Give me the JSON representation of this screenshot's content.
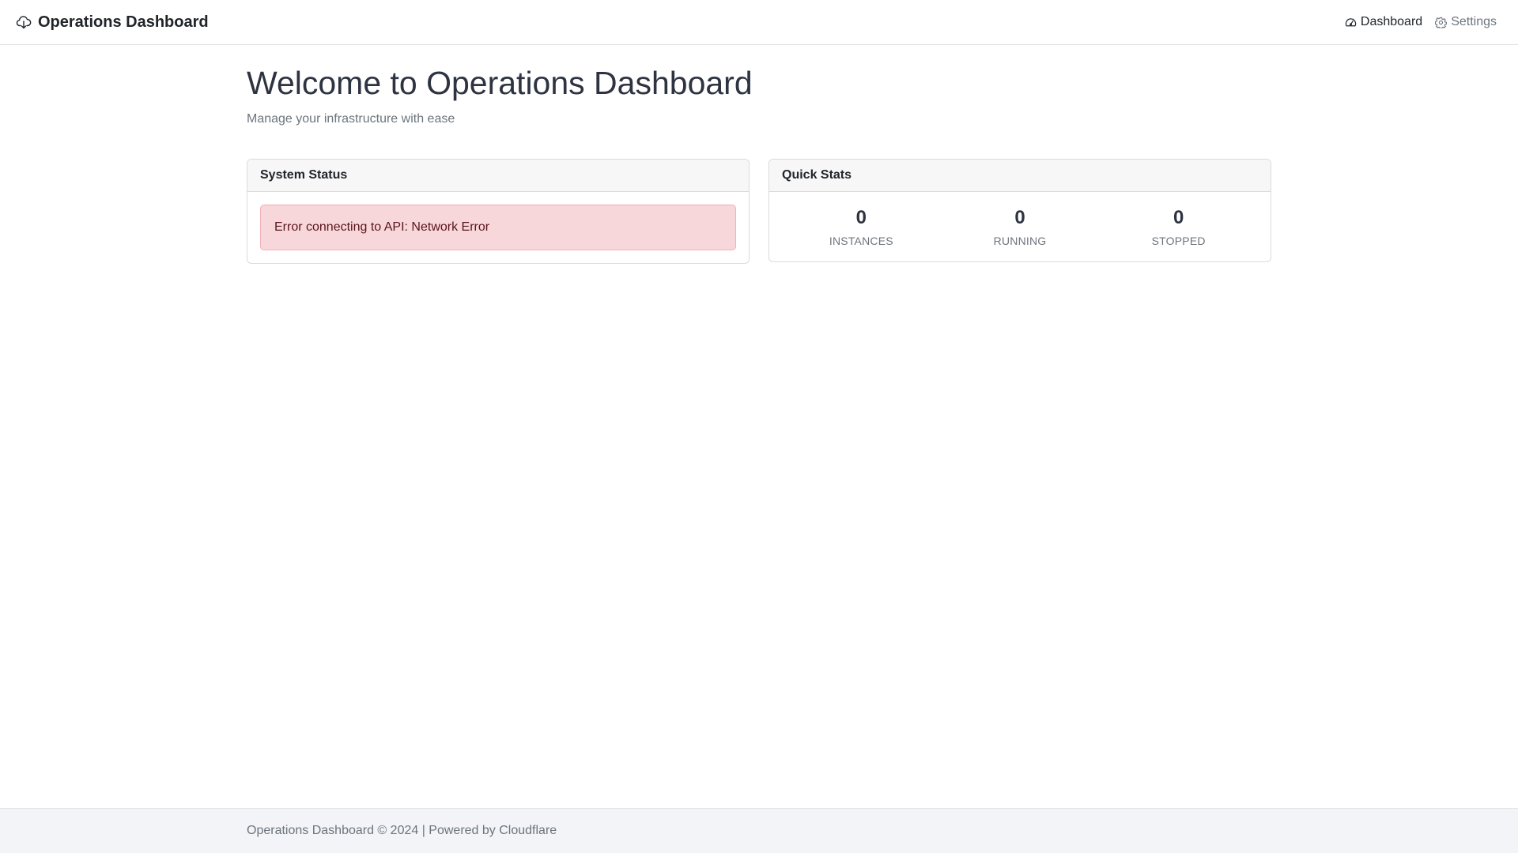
{
  "navbar": {
    "brand_title": "Operations Dashboard",
    "brand_icon": "cloud-download-icon",
    "links": [
      {
        "label": "Dashboard",
        "icon": "speedometer-icon",
        "active": true
      },
      {
        "label": "Settings",
        "icon": "gear-icon",
        "active": false
      }
    ]
  },
  "main": {
    "title": "Welcome to Operations Dashboard",
    "subtitle": "Manage your infrastructure with ease"
  },
  "system_status": {
    "header": "System Status",
    "error_message": "Error connecting to API: Network Error",
    "error_color": "#f8d7da"
  },
  "quick_stats": {
    "header": "Quick Stats",
    "stats": [
      {
        "value": "0",
        "label": "INSTANCES"
      },
      {
        "value": "0",
        "label": "RUNNING"
      },
      {
        "value": "0",
        "label": "STOPPED"
      }
    ]
  },
  "footer": {
    "text": "Operations Dashboard © 2024 | Powered by Cloudflare"
  }
}
